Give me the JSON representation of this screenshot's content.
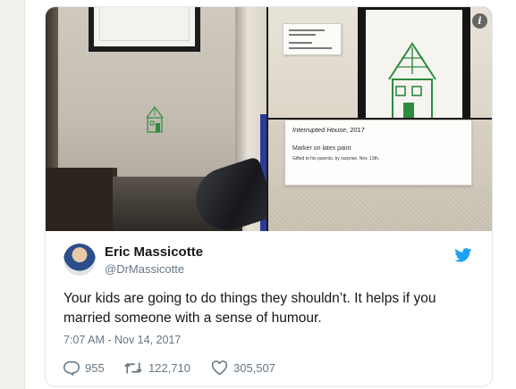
{
  "media": {
    "label_card": {
      "title": "Interrupted House",
      "year": ", 2017",
      "medium": "Marker on latex paint",
      "note": "Gifted to his parents, by surprise. Nov. 13th."
    },
    "info_icon": "i"
  },
  "tweet": {
    "author": {
      "display_name": "Eric Massicotte",
      "handle": "@DrMassicotte"
    },
    "text": "Your kids are going to do things they shouldn’t. It helps if you married someone with a sense of humour.",
    "timestamp": "7:07 AM - Nov 14, 2017",
    "actions": {
      "replies": "955",
      "retweets": "122,710",
      "likes": "305,507"
    }
  },
  "icons": {
    "brand": "twitter-bird-icon",
    "reply": "reply-icon",
    "retweet": "retweet-icon",
    "like": "heart-icon",
    "info": "info-icon"
  },
  "colors": {
    "twitter_blue": "#1da1f2",
    "text": "#14171a",
    "muted": "#657786",
    "border": "#e1e8ed",
    "marker_green": "#2e8b3e"
  }
}
